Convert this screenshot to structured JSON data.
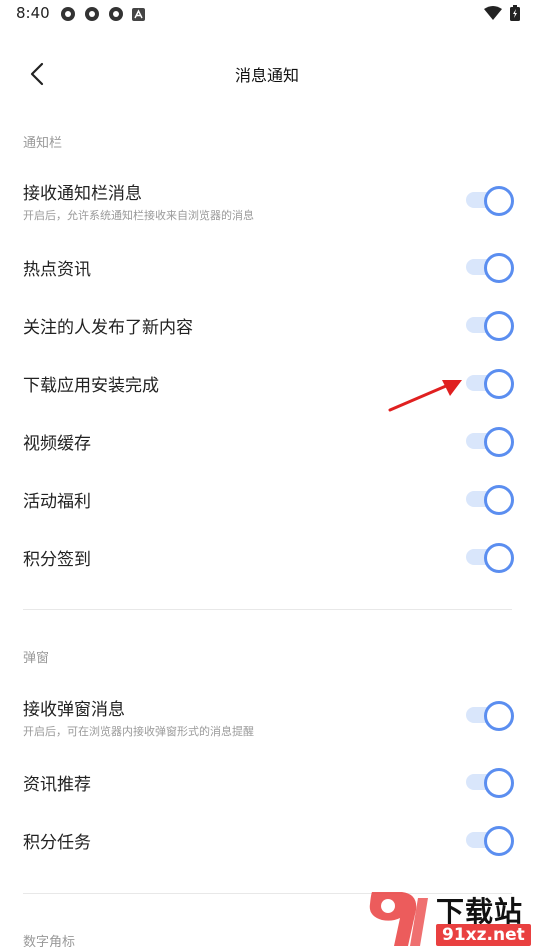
{
  "status_bar": {
    "time": "8:40"
  },
  "header": {
    "title": "消息通知"
  },
  "sections": {
    "notification_bar": {
      "label": "通知栏",
      "items": [
        {
          "title": "接收通知栏消息",
          "subtitle": "开启后，允许系统通知栏接收来自浏览器的消息",
          "enabled": true
        },
        {
          "title": "热点资讯",
          "enabled": true
        },
        {
          "title": "关注的人发布了新内容",
          "enabled": true
        },
        {
          "title": "下载应用安装完成",
          "enabled": true
        },
        {
          "title": "视频缓存",
          "enabled": true
        },
        {
          "title": "活动福利",
          "enabled": true
        },
        {
          "title": "积分签到",
          "enabled": true
        }
      ]
    },
    "popup": {
      "label": "弹窗",
      "items": [
        {
          "title": "接收弹窗消息",
          "subtitle": "开启后，可在浏览器内接收弹窗形式的消息提醒",
          "enabled": true
        },
        {
          "title": "资讯推荐",
          "enabled": true
        },
        {
          "title": "积分任务",
          "enabled": true
        }
      ]
    },
    "badge": {
      "label": "数字角标"
    }
  },
  "watermark": {
    "name": "下载站",
    "url": "91xz.net"
  },
  "colors": {
    "accent": "#5b8ef0",
    "track": "#d9e6fb",
    "annotation": "#e02020"
  }
}
